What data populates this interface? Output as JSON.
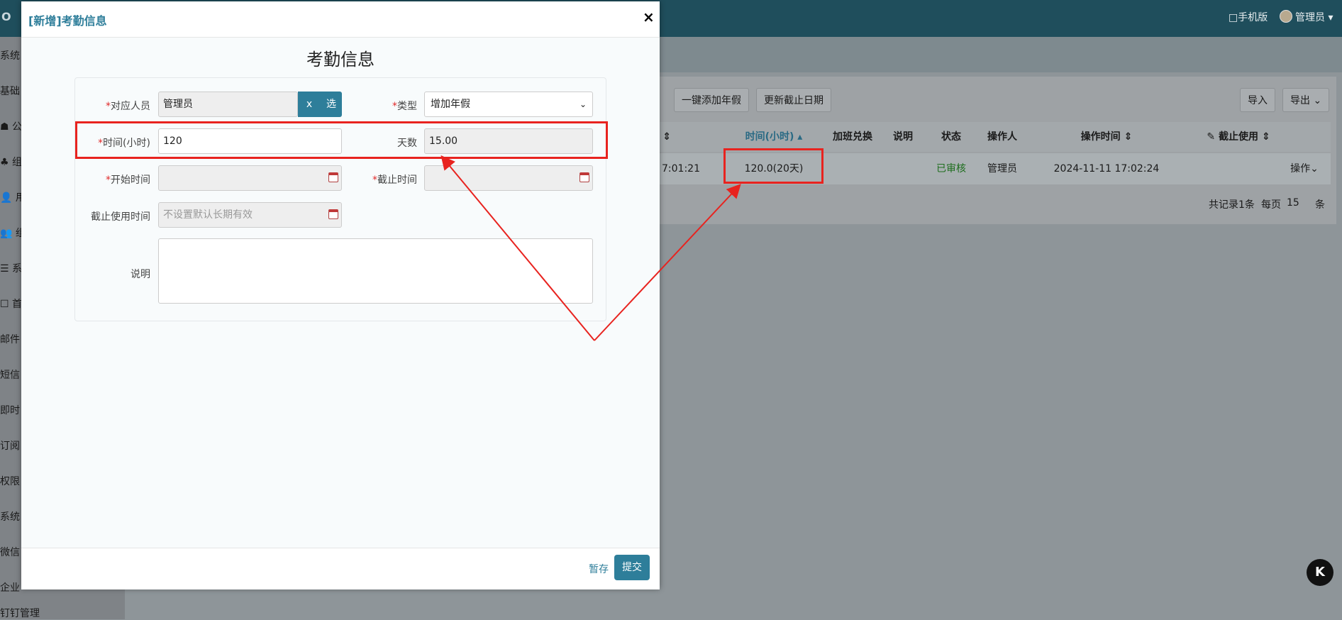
{
  "topbar": {
    "logo": "O",
    "mobile": "□手机版",
    "user": "管理员 ▾"
  },
  "sidebar": {
    "items": [
      "系统",
      "基础",
      "☗ 公",
      "♣ 组",
      "👤 用",
      "👥 组",
      "☰ 系",
      "☐ 首",
      "邮件",
      "短信",
      "即时",
      "订阅",
      "权限",
      "系统",
      "微信",
      "企业",
      "钉钉管理"
    ]
  },
  "toolbar": {
    "add_annual_leave": "一键添加年假",
    "update_deadline": "更新截止日期",
    "import": "导入",
    "export": "导出 ⌄"
  },
  "table": {
    "headers": [
      "时间(小时)",
      "加班兑换",
      "说明",
      "状态",
      "操作人",
      "操作时间",
      "截止使用"
    ],
    "partial_header_sort": "⇕",
    "row": {
      "partial_time": "7:01:21",
      "hours": "120.0(20天)",
      "status": "已审核",
      "operator": "管理员",
      "op_time": "2024-11-11 17:02:24",
      "action": "操作⌄"
    }
  },
  "pager": {
    "total": "共记录1条",
    "per_page_label": "每页",
    "per_page": "15",
    "unit": "条"
  },
  "modal": {
    "title": "[新增]考勤信息",
    "close": "×",
    "form_title": "考勤信息",
    "fields": {
      "person_label": "对应人员",
      "person_value": "管理员",
      "clear_btn": "x",
      "select_btn": "选",
      "type_label": "类型",
      "type_value": "增加年假",
      "hours_label": "时间(小时)",
      "hours_value": "120",
      "days_label": "天数",
      "days_value": "15.00",
      "start_label": "开始时间",
      "end_label": "截止时间",
      "use_deadline_label": "截止使用时间",
      "use_deadline_placeholder": "不设置默认长期有效",
      "desc_label": "说明",
      "required_mark": "*"
    },
    "save": "暂存",
    "submit": "提交"
  },
  "badge": "K",
  "colors": {
    "accent": "#2e7e9a",
    "annotation": "#e8231f",
    "approved": "#1e6e1e"
  }
}
